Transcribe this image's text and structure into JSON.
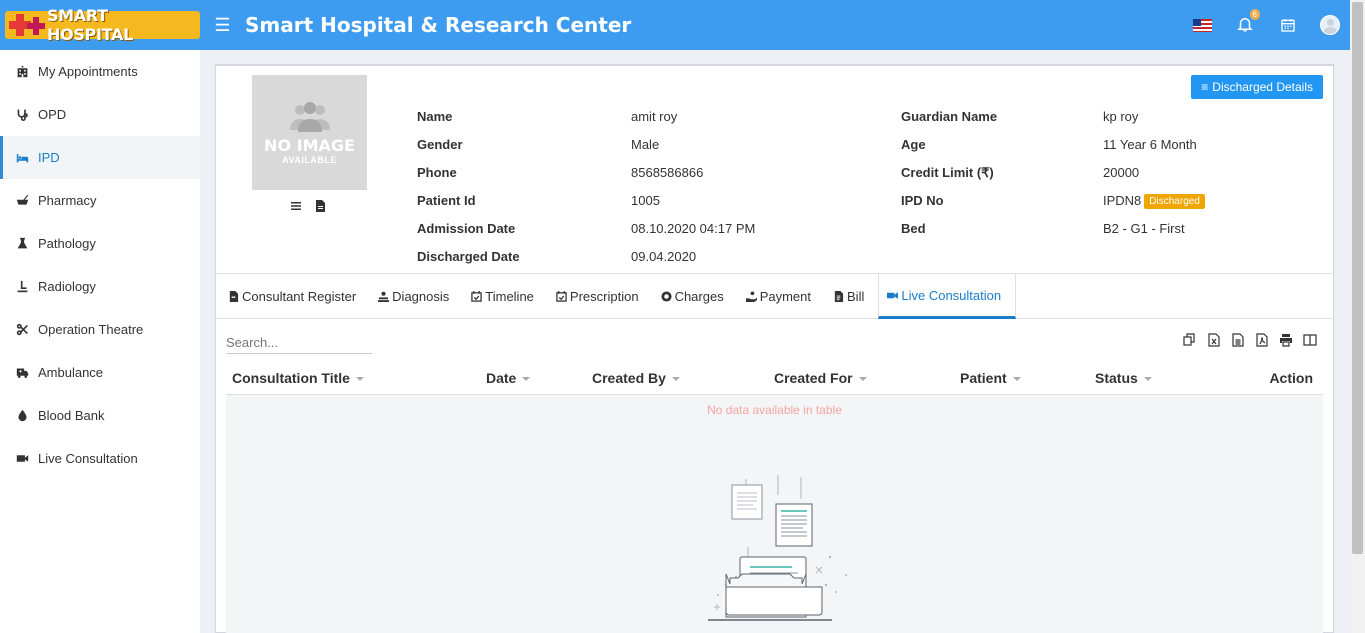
{
  "header": {
    "brand": "SMART HOSPITAL",
    "title": "Smart Hospital & Research Center",
    "notification_count": "6"
  },
  "sidebar": {
    "items": [
      {
        "label": "My Appointments",
        "icon": "hospital-building-icon"
      },
      {
        "label": "OPD",
        "icon": "stethoscope-icon"
      },
      {
        "label": "IPD",
        "icon": "bed-icon",
        "active": true
      },
      {
        "label": "Pharmacy",
        "icon": "mortar-pestle-icon"
      },
      {
        "label": "Pathology",
        "icon": "flask-icon"
      },
      {
        "label": "Radiology",
        "icon": "xray-icon"
      },
      {
        "label": "Operation Theatre",
        "icon": "scissors-icon"
      },
      {
        "label": "Ambulance",
        "icon": "ambulance-icon"
      },
      {
        "label": "Blood Bank",
        "icon": "blood-drop-icon"
      },
      {
        "label": "Live Consultation",
        "icon": "video-camera-icon"
      }
    ]
  },
  "profile": {
    "no_image_line1": "NO IMAGE",
    "no_image_line2": "AVAILABLE",
    "discharged_details_label": "Discharged Details",
    "fields_left": [
      {
        "label": "Name",
        "value": "amit roy"
      },
      {
        "label": "Gender",
        "value": "Male"
      },
      {
        "label": "Phone",
        "value": "8568586866"
      },
      {
        "label": "Patient Id",
        "value": "1005"
      },
      {
        "label": "Admission Date",
        "value": "08.10.2020 04:17 PM"
      },
      {
        "label": "Discharged Date",
        "value": "09.04.2020"
      }
    ],
    "fields_right": [
      {
        "label": "Guardian Name",
        "value": "kp roy"
      },
      {
        "label": "Age",
        "value": "11 Year 6 Month"
      },
      {
        "label": "Credit Limit (₹)",
        "value": "20000"
      },
      {
        "label": "IPD No",
        "value": "IPDN8"
      },
      {
        "label": "Bed",
        "value": "B2 - G1 - First"
      }
    ],
    "ipd_status": "Discharged"
  },
  "tabs": [
    {
      "label": "Consultant Register"
    },
    {
      "label": "Diagnosis"
    },
    {
      "label": "Timeline"
    },
    {
      "label": "Prescription"
    },
    {
      "label": "Charges"
    },
    {
      "label": "Payment"
    },
    {
      "label": "Bill"
    },
    {
      "label": "Live Consultation",
      "active": true
    }
  ],
  "table": {
    "search_placeholder": "Search...",
    "columns": [
      "Consultation Title",
      "Date",
      "Created By",
      "Created For",
      "Patient",
      "Status",
      "Action"
    ],
    "empty_message": "No data available in table"
  },
  "colors": {
    "header_bg": "#3d9cf0",
    "accent": "#1a7dc9",
    "discharged_badge": "#f0a500"
  }
}
